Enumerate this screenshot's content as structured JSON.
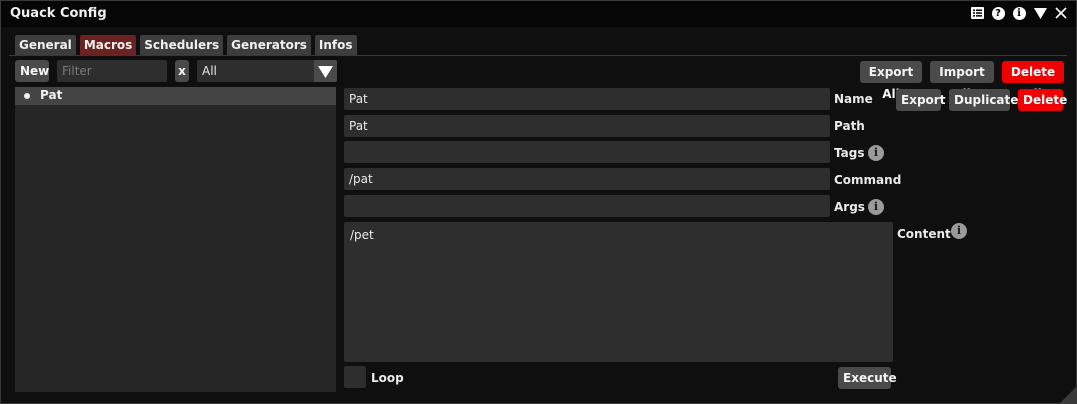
{
  "window": {
    "title": "Quack Config"
  },
  "title_icons": [
    "list-icon",
    "help-icon",
    "info-icon",
    "collapse-icon",
    "close-icon"
  ],
  "tabs": [
    {
      "label": "General",
      "active": false
    },
    {
      "label": "Macros",
      "active": true
    },
    {
      "label": "Schedulers",
      "active": false
    },
    {
      "label": "Generators",
      "active": false
    },
    {
      "label": "Infos",
      "active": false
    }
  ],
  "toolbar": {
    "new_label": "New",
    "filter_placeholder": "Filter",
    "clear_label": "x",
    "filter_select_value": "All",
    "export_all_label": "Export All",
    "import_all_label": "Import All",
    "delete_all_label": "Delete All"
  },
  "macro_list": {
    "items": [
      {
        "label": "Pat"
      }
    ]
  },
  "editor": {
    "name_value": "Pat",
    "name_label": "Name",
    "path_value": "Pat",
    "path_label": "Path",
    "tags_value": "",
    "tags_label": "Tags",
    "command_value": "/pat",
    "command_label": "Command",
    "args_value": "",
    "args_label": "Args",
    "content_value": "/pet",
    "content_label": "Content",
    "loop_label": "Loop",
    "export_label": "Export",
    "duplicate_label": "Duplicate",
    "delete_label": "Delete",
    "execute_label": "Execute",
    "info_glyph": "i"
  },
  "colors": {
    "accent_tab": "#6b2222",
    "danger": "#f00000"
  }
}
